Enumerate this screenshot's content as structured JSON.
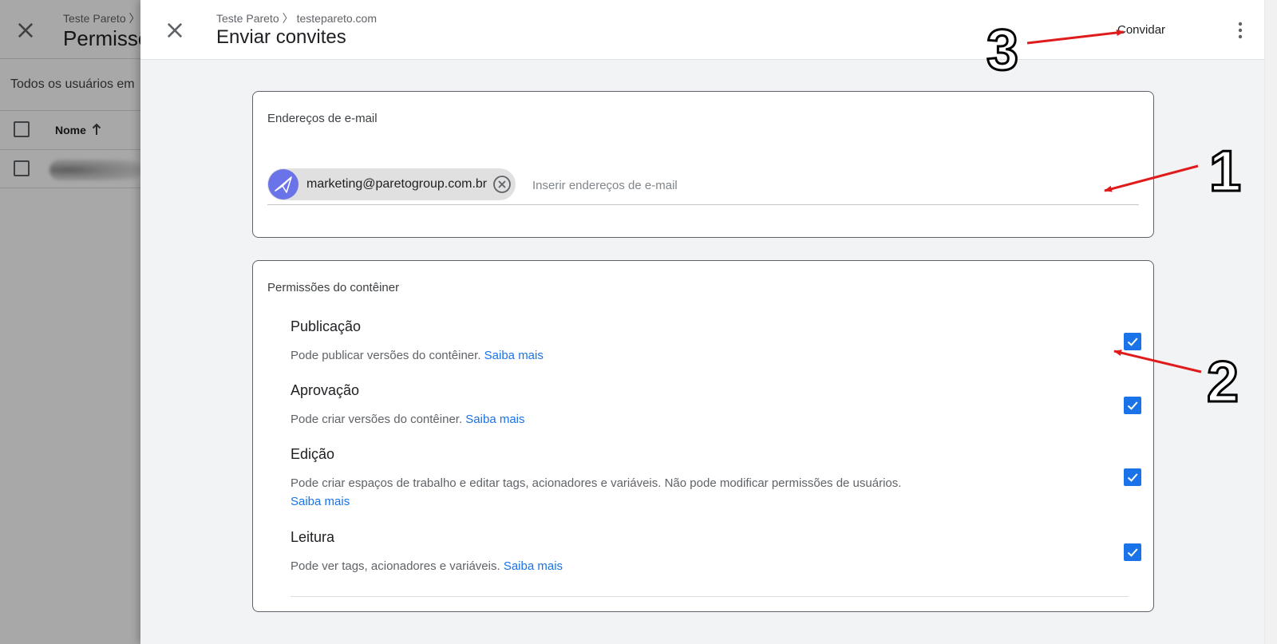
{
  "background": {
    "breadcrumb": "Teste Pareto 〉 t",
    "title": "Permissõ",
    "subtitle": "Todos os usuários em",
    "table": {
      "name_header": "Nome"
    }
  },
  "dialog": {
    "breadcrumb_account": "Teste Pareto",
    "breadcrumb_container": "testepareto.com",
    "title": "Enviar convites",
    "invite_label": "Convidar"
  },
  "email_section": {
    "title": "Endereços de e-mail",
    "chips": [
      {
        "email": "marketing@paretogroup.com.br"
      }
    ],
    "input_placeholder": "Inserir endereços de e-mail",
    "input_value": ""
  },
  "permissions_section": {
    "title": "Permissões do contêiner",
    "items": [
      {
        "title": "Publicação",
        "description": "Pode publicar versões do contêiner.",
        "link": "Saiba mais",
        "checked": true
      },
      {
        "title": "Aprovação",
        "description": "Pode criar versões do contêiner.",
        "link": "Saiba mais",
        "checked": true
      },
      {
        "title": "Edição",
        "description": "Pode criar espaços de trabalho e editar tags, acionadores e variáveis. Não pode modificar permissões de usuários.",
        "link": "Saiba mais",
        "checked": true
      },
      {
        "title": "Leitura",
        "description": "Pode ver tags, acionadores e variáveis.",
        "link": "Saiba mais",
        "checked": true
      }
    ]
  },
  "annotations": {
    "labels": [
      "1",
      "2",
      "3"
    ],
    "arrow_color": "#e01b1b"
  },
  "colors": {
    "accent": "#1a73e8",
    "panel_background": "#f1f3f4",
    "chip_avatar": "#6a73e8"
  },
  "icons": [
    "close-icon",
    "more-vert-icon",
    "cancel-circle-icon",
    "check-icon",
    "arrow-upward-icon",
    "paper-plane-icon"
  ]
}
